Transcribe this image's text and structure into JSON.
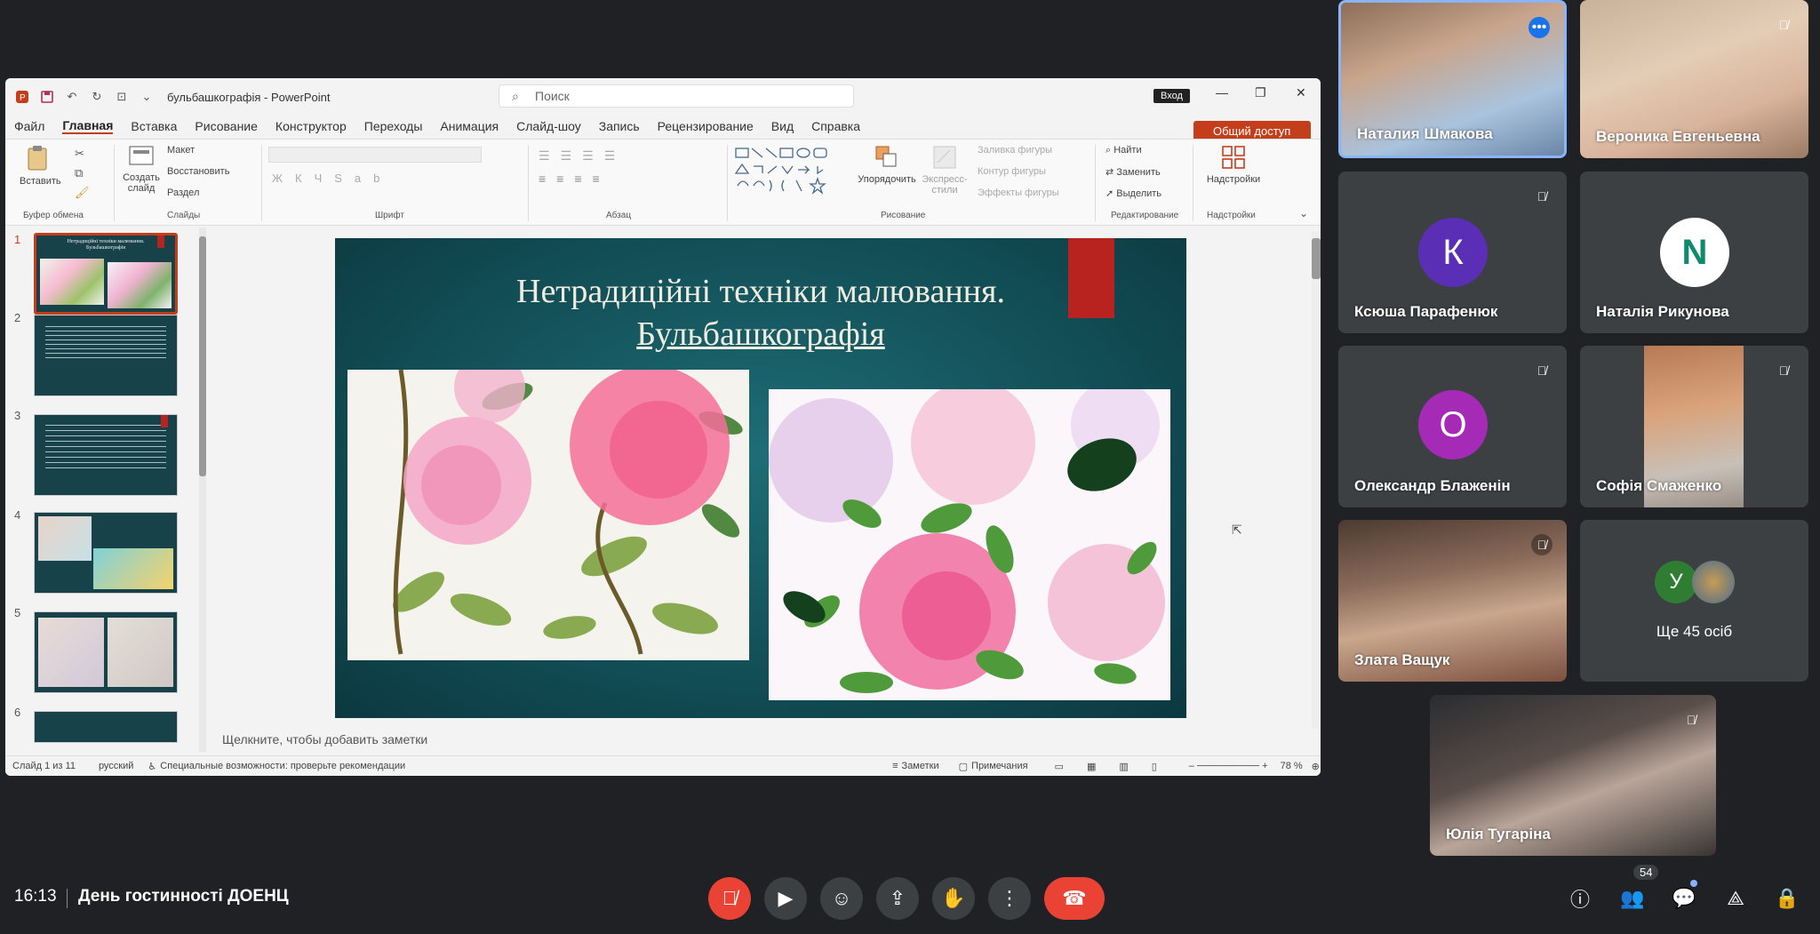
{
  "powerpoint": {
    "file_title": "бульбашкографія - PowerPoint",
    "search_placeholder": "Поиск",
    "signin": "Вход",
    "share": "Общий доступ",
    "menu": [
      "Файл",
      "Главная",
      "Вставка",
      "Рисование",
      "Конструктор",
      "Переходы",
      "Анимация",
      "Слайд-шоу",
      "Запись",
      "Рецензирование",
      "Вид",
      "Справка"
    ],
    "ribbon": {
      "paste": "Вставить",
      "new_slide": "Создать слайд",
      "layout": "Макет",
      "reset": "Восстановить",
      "section": "Раздел",
      "arrange": "Упорядочить",
      "quick_styles": "Экспресс-стили",
      "shape_fill": "Заливка фигуры",
      "shape_outline": "Контур фигуры",
      "shape_effects": "Эффекты фигуры",
      "find": "Найти",
      "replace": "Заменить",
      "select": "Выделить",
      "addins": "Надстройки",
      "groups": {
        "clipboard": "Буфер обмена",
        "slides": "Слайды",
        "font": "Шрифт",
        "paragraph": "Абзац",
        "drawing": "Рисование",
        "editing": "Редактирование",
        "addins": "Надстройки"
      }
    },
    "thumbnails": [
      "1",
      "2",
      "3",
      "4",
      "5",
      "6"
    ],
    "thumb1_title": "Нетрадиційні техніки малювання. Бульбашкографія",
    "slide_title_line1": "Нетрадиційні техніки малювання.",
    "slide_title_line2": "Бульбашкографія",
    "notes_placeholder": "Щелкните, чтобы добавить заметки",
    "status": {
      "slide": "Слайд 1 из 11",
      "language": "русский",
      "accessibility": "Специальные возможности: проверьте рекомендации",
      "notes": "Заметки",
      "comments": "Примечания",
      "zoom": "78 %"
    }
  },
  "participants": [
    {
      "name": "Наталия Шмакова"
    },
    {
      "name": "Вероника Евгеньевна"
    },
    {
      "name": "Ксюша Парафенюк",
      "initial": "К",
      "color": "#5b2fb5"
    },
    {
      "name": "Наталія Рикунова",
      "initial": "N",
      "color": "#ffffff"
    },
    {
      "name": "Олександр Блаженін",
      "initial": "О",
      "color": "#a52bb6"
    },
    {
      "name": "Софія Смаженко"
    },
    {
      "name": "Злата Ващук"
    },
    {
      "name": "Ще 45 осіб",
      "initial": "У",
      "color": "#2e7d32"
    },
    {
      "name": "Юлія Тугаріна"
    }
  ],
  "meeting": {
    "time": "16:13",
    "title": "День гостинності ДОЕНЦ",
    "people_count": "54"
  },
  "colors": {
    "end_call": "#ea4335",
    "mic_off": "#ea4335",
    "accent": "#c43e1c"
  }
}
